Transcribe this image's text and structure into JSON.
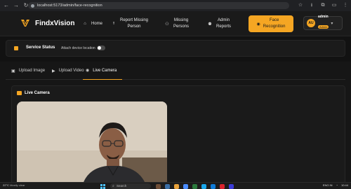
{
  "browser": {
    "url": "localhost:5173/admin/face-recognition",
    "nav_icons": [
      "back-icon",
      "forward-icon",
      "reload-icon"
    ],
    "right_icons": [
      "star-icon",
      "download-icon",
      "extensions-icon",
      "sidebar-icon",
      "profile-icon"
    ]
  },
  "app": {
    "brand": "FindxVision",
    "nav": [
      {
        "label": "Home",
        "icon": "home-icon"
      },
      {
        "label": "Report Missing\nPerson",
        "icon": "upload-icon"
      },
      {
        "label": "Missing\nPersons",
        "icon": "user-icon"
      },
      {
        "label": "Admin\nReports",
        "icon": "users-icon"
      }
    ],
    "active_nav": {
      "label": "Face\nRecognition",
      "icon": "camera-icon"
    },
    "user": {
      "initials": "AU",
      "name": "admin",
      "role": "Admin"
    },
    "colors": {
      "accent": "#f5a623",
      "bg": "#121212",
      "panel": "#1a1a1a"
    }
  },
  "service": {
    "title": "Service Status",
    "attach_label": "Attach device location",
    "attach_enabled": false
  },
  "tabs": [
    {
      "label": "Upload Image",
      "icon": "image-icon"
    },
    {
      "label": "Upload Video",
      "icon": "video-icon"
    },
    {
      "label": "Live Camera",
      "icon": "camera-icon",
      "active": true
    }
  ],
  "camera": {
    "title": "Live Camera"
  },
  "taskbar": {
    "temp": "22°C",
    "weather": "Mostly clear",
    "search_placeholder": "Search",
    "lang": "ENG\nIN",
    "time": "10:44"
  }
}
